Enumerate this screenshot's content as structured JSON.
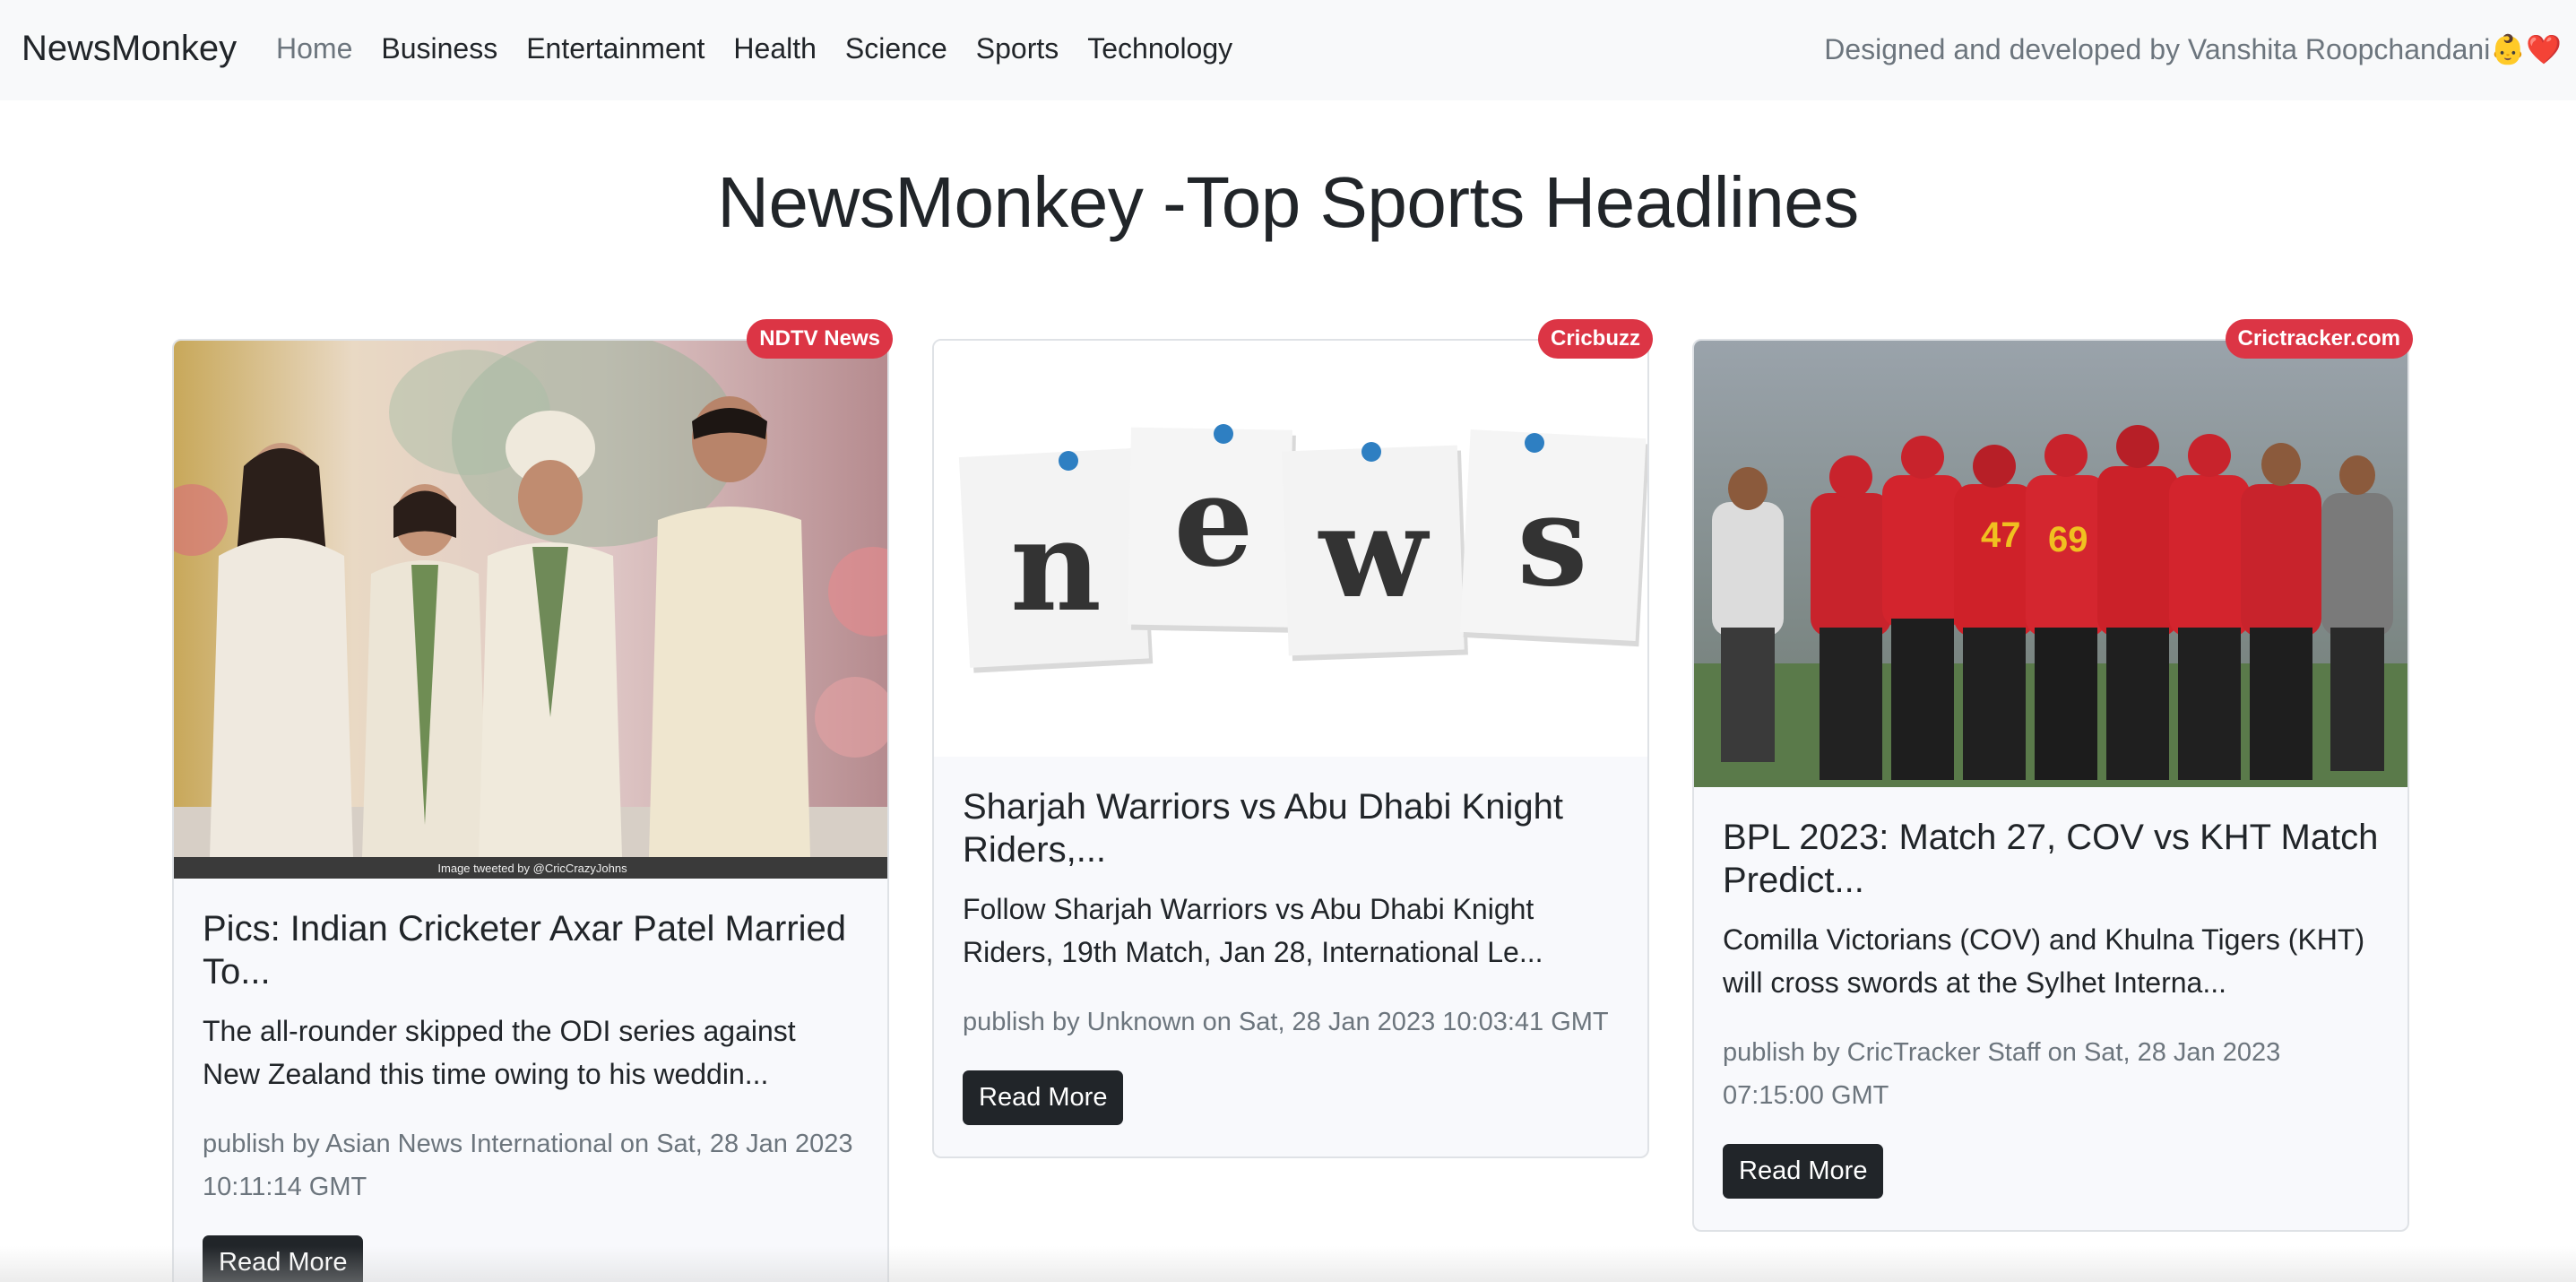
{
  "navbar": {
    "brand": "NewsMonkey",
    "links": [
      "Home",
      "Business",
      "Entertainment",
      "Health",
      "Science",
      "Sports",
      "Technology"
    ],
    "credit": "Designed and developed by Vanshita Roopchandani👶❤️"
  },
  "heading": "NewsMonkey -Top Sports Headlines",
  "articles": [
    {
      "source": "NDTV News",
      "title": "Pics: Indian Cricketer Axar Patel Married To...",
      "description": "The all-rounder skipped the ODI series against New Zealand this time owing to his weddin...",
      "meta": "publish by Asian News International on Sat, 28 Jan 2023 10:11:14 GMT",
      "button": "Read More",
      "image_caption": "Image tweeted by @CricCrazyJohns"
    },
    {
      "source": "Cricbuzz",
      "title": "Sharjah Warriors vs Abu Dhabi Knight Riders,...",
      "description": "Follow Sharjah Warriors vs Abu Dhabi Knight Riders, 19th Match, Jan 28, International Le...",
      "meta": "publish by Unknown on Sat, 28 Jan 2023 10:03:41 GMT",
      "button": "Read More",
      "image_letters": [
        "n",
        "e",
        "w",
        "s"
      ]
    },
    {
      "source": "Crictracker.com",
      "title": "BPL 2023: Match 27, COV vs KHT Match Predict...",
      "description": "Comilla Victorians (COV) and Khulna Tigers (KHT) will cross swords at the Sylhet Interna...",
      "meta": "publish by CricTracker Staff on Sat, 28 Jan 2023 07:15:00 GMT",
      "button": "Read More"
    }
  ],
  "colors": {
    "navbar_bg": "#f8f9fa",
    "badge": "#dc3545",
    "button": "#212529",
    "muted": "#6c757d"
  }
}
